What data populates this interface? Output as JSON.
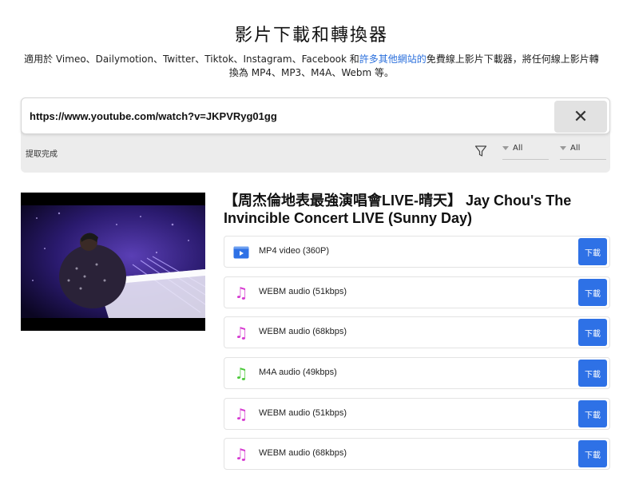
{
  "header": {
    "title": "影片下載和轉換器",
    "subtitle_before": "適用於 Vimeo、Dailymotion、Twitter、Tiktok、Instagram、Facebook 和",
    "subtitle_link": "許多其他網站的",
    "subtitle_after": "免費線上影片下載器，將任何線上影片轉換為 MP4、MP3、M4A、Webm 等。"
  },
  "search": {
    "url": "https://www.youtube.com/watch?v=JKPVRyg01gg",
    "clear_symbol": "✕",
    "status": "提取完成",
    "filter_icon": "funnel-icon",
    "filter1_value": "All",
    "filter2_value": "All"
  },
  "video": {
    "title": "【周杰倫地表最強演唱會LIVE-晴天】 Jay Chou's The Invincible Concert LIVE (Sunny Day)"
  },
  "formats": [
    {
      "label": "MP4 video (360P)",
      "icon": "video-icon",
      "color": "#2e71e6",
      "button": "下載"
    },
    {
      "label": "WEBM audio (51kbps)",
      "icon": "music-note-icon",
      "color": "#d63ad1",
      "button": "下載"
    },
    {
      "label": "WEBM audio (68kbps)",
      "icon": "music-note-icon",
      "color": "#d63ad1",
      "button": "下載"
    },
    {
      "label": "M4A audio (49kbps)",
      "icon": "music-note-icon",
      "color": "#4cc93a",
      "button": "下載"
    },
    {
      "label": "WEBM audio (51kbps)",
      "icon": "music-note-icon",
      "color": "#d63ad1",
      "button": "下載"
    },
    {
      "label": "WEBM audio (68kbps)",
      "icon": "music-note-icon",
      "color": "#d63ad1",
      "button": "下載"
    }
  ],
  "colors": {
    "accent": "#2e71e6",
    "link": "#2a6fdc"
  }
}
